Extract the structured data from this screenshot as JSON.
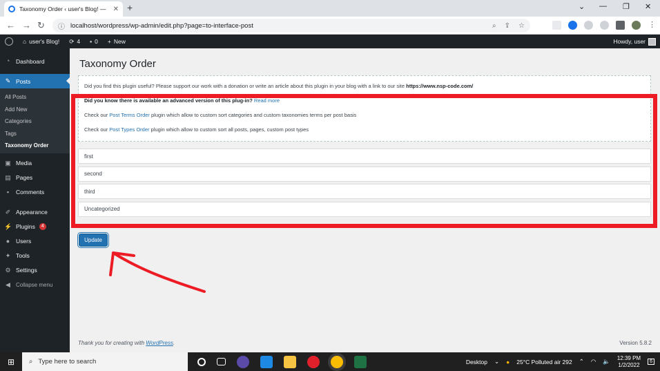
{
  "browser": {
    "tab_title": "Taxonomy Order ‹ user's Blog! —",
    "url": "localhost/wordpress/wp-admin/edit.php?page=to-interface-post",
    "win_min": "⌄",
    "win_minimize": "—",
    "win_restore": "❐",
    "win_close": "✕"
  },
  "adminbar": {
    "site_name": "user's Blog!",
    "updates_count": "4",
    "comments_count": "0",
    "new_label": "New",
    "howdy": "Howdy, user"
  },
  "sidebar": {
    "dashboard": "Dashboard",
    "posts": "Posts",
    "sub_items": [
      "All Posts",
      "Add New",
      "Categories",
      "Tags",
      "Taxonomy Order"
    ],
    "media": "Media",
    "pages": "Pages",
    "comments": "Comments",
    "appearance": "Appearance",
    "plugins": "Plugins",
    "plugins_badge": "4",
    "users": "Users",
    "tools": "Tools",
    "settings": "Settings",
    "collapse": "Collapse menu"
  },
  "page": {
    "title": "Taxonomy Order",
    "notice": {
      "line1": "Did you find this plugin useful? Please support our work with a donation or write an article about this plugin in your blog with a link to our site",
      "line1_url": "https://www.nsp-code.com/",
      "line2_bold": "Did you know there is available an advanced version of this plug-in?",
      "line2_link": "Read more",
      "line3_pre": "Check our",
      "line3_link": "Post Terms Order",
      "line3_post": "plugin which allow to custom sort categories and custom taxonomies terms per post basis",
      "line4_pre": "Check our",
      "line4_link": "Post Types Order",
      "line4_post": "plugin which allow to custom sort all posts, pages, custom post types"
    },
    "terms": [
      "first",
      "second",
      "third",
      "Uncategorized"
    ],
    "update_button": "Update",
    "footer_left_pre": "Thank you for creating with",
    "footer_left_link": "WordPress",
    "footer_left_post": ".",
    "footer_right": "Version 5.8.2"
  },
  "taskbar": {
    "search_placeholder": "Type here to search",
    "desktop": "Desktop",
    "weather": "25°C  Polluted air 292",
    "time": "12:39 PM",
    "date": "1/2/2022",
    "notif_count": "6"
  },
  "colors": {
    "wp_dark": "#1d2327",
    "wp_blue": "#2271b1",
    "annotation_red": "#ed1c24"
  }
}
